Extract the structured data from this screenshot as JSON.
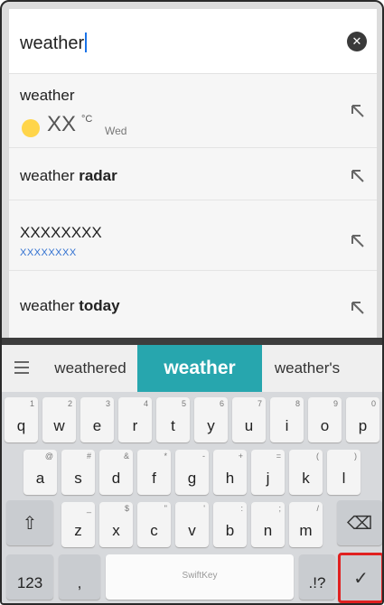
{
  "search": {
    "query": "weather",
    "clear_icon": "close-icon"
  },
  "suggestions": [
    {
      "text_plain": "weather",
      "text_bold": "",
      "temperature": "XX",
      "unit": "°C",
      "day": "Wed",
      "icon": "sun-icon"
    },
    {
      "text_plain": "weather ",
      "text_bold": "radar"
    },
    {
      "text_plain": "XXXXXXXX",
      "text_bold": "",
      "subtext": "XXXXXXXX"
    },
    {
      "text_plain": "weather ",
      "text_bold": "today"
    }
  ],
  "prediction_bar": {
    "left": "weathered",
    "middle": "weather",
    "right": "weather's",
    "accent_color": "#27a6ae"
  },
  "keyboard": {
    "row1": [
      {
        "m": "q",
        "h": "1"
      },
      {
        "m": "w",
        "h": "2"
      },
      {
        "m": "e",
        "h": "3"
      },
      {
        "m": "r",
        "h": "4"
      },
      {
        "m": "t",
        "h": "5"
      },
      {
        "m": "y",
        "h": "6"
      },
      {
        "m": "u",
        "h": "7"
      },
      {
        "m": "i",
        "h": "8"
      },
      {
        "m": "o",
        "h": "9"
      },
      {
        "m": "p",
        "h": "0"
      }
    ],
    "row2": [
      {
        "m": "a",
        "h": "@"
      },
      {
        "m": "s",
        "h": "#"
      },
      {
        "m": "d",
        "h": "&"
      },
      {
        "m": "f",
        "h": "*"
      },
      {
        "m": "g",
        "h": "-"
      },
      {
        "m": "h",
        "h": "+"
      },
      {
        "m": "j",
        "h": "="
      },
      {
        "m": "k",
        "h": "("
      },
      {
        "m": "l",
        "h": ")"
      }
    ],
    "row3": [
      {
        "m": "z",
        "h": "_"
      },
      {
        "m": "x",
        "h": "$"
      },
      {
        "m": "c",
        "h": "\""
      },
      {
        "m": "v",
        "h": "'"
      },
      {
        "m": "b",
        "h": ":"
      },
      {
        "m": "n",
        "h": ";"
      },
      {
        "m": "m",
        "h": "/"
      }
    ],
    "numbers_label": "123",
    "comma_label": ",",
    "space_brand": "SwiftKey",
    "punct_label": ".!?",
    "shift_icon": "shift-icon",
    "backspace_icon": "backspace-icon",
    "enter_icon": "checkmark-icon",
    "highlight_color": "#e02020"
  }
}
